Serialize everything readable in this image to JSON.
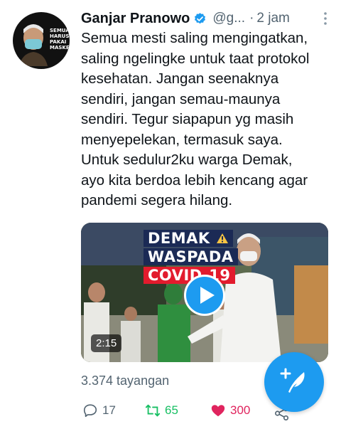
{
  "tweet": {
    "author_name": "Ganjar Pranowo",
    "handle": "@g...",
    "separator": "·",
    "time": "2 jam",
    "avatar_slogan": [
      "SEMUA",
      "HARUS",
      "PAKAI",
      "MASKER"
    ],
    "text_lines": [
      "Semua mesti saling mengingatkan,",
      "saling ngelingke untuk taat protokol",
      "kesehatan. Jangan seenaknya",
      "sendiri, jangan semau-maunya",
      "sendiri. Tegur siapapun yg masih",
      "menyepelekan, termasuk saya.",
      "Untuk sedulur2ku warga Demak,",
      "ayo kita berdoa lebih kencang agar",
      "pandemi segera hilang."
    ],
    "video": {
      "overlay_line1": "DEMAK",
      "overlay_line2": "WASPADA",
      "overlay_line3": "COVID-19",
      "duration": "2:15"
    },
    "views": "3.374 tayangan",
    "actions": {
      "replies": "17",
      "retweets": "65",
      "likes": "300"
    }
  },
  "colors": {
    "accent": "#1d9bf0",
    "retweet": "#17bf63",
    "like": "#e0245e",
    "muted": "#536471"
  },
  "icons": [
    "verified-badge-icon",
    "more-vertical-icon",
    "play-icon",
    "reply-icon",
    "retweet-icon",
    "heart-icon",
    "share-icon",
    "compose-tweet-icon",
    "warning-icon"
  ]
}
